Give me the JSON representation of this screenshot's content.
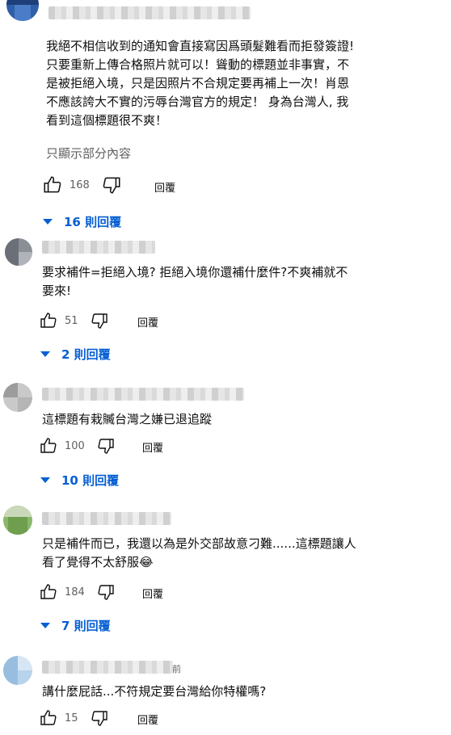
{
  "colors": {
    "text": "#0f0f0f",
    "secondary": "#606060",
    "link": "#065fd4"
  },
  "comments": [
    {
      "name_tail": "",
      "text": "我絕不相信收到的通知會直接寫因爲頭髮難看而拒發簽證!\n只要重新上傳合格照片就可以！聳動的標題並非事實，不\n是被拒絕入境，只是因照片不合規定要再補上一次！肖恩\n不應該誇大不實的污辱台灣官方的規定！ 身為台灣人, 我\n看到這個標題很不爽！",
      "more_label": "只顯示部分內容",
      "likes": "168",
      "reply_label": "回覆",
      "replies_label": "16 則回覆"
    },
    {
      "name_tail": "",
      "text": "要求補件=拒絕入境? 拒絕入境你還補什麼件?不爽補就不\n要來!",
      "likes": "51",
      "reply_label": "回覆",
      "replies_label": "2 則回覆"
    },
    {
      "name_tail": "",
      "text": "這標題有栽贓台灣之嫌已退追蹤",
      "likes": "100",
      "reply_label": "回覆",
      "replies_label": "10 則回覆"
    },
    {
      "name_tail": "",
      "text": "只是補件而已，我還以為是外交部故意刁難......這標題讓人\n看了覺得不太舒服😂",
      "likes": "184",
      "reply_label": "回覆",
      "replies_label": "7 則回覆"
    },
    {
      "name_tail": "前",
      "text": "講什麼屁話...不符規定要台灣給你特權嗎?",
      "likes": "15",
      "reply_label": "回覆"
    }
  ]
}
